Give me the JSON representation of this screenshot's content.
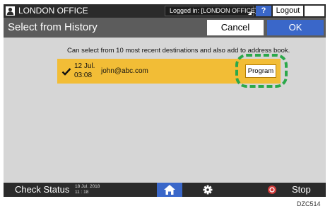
{
  "topbar": {
    "office_label": "LONDON OFFICE",
    "login_status": "Logged in: [LONDON OFFICE]",
    "help_label": "?",
    "logout_label": "Logout",
    "icons": [
      "user-icon",
      "energy-saver-icon"
    ]
  },
  "titlebar": {
    "title": "Select from History",
    "cancel_label": "Cancel",
    "ok_label": "OK"
  },
  "main": {
    "info_text": "Can select from 10 most recent destinations and also add to address book.",
    "history_rows": [
      {
        "checked": true,
        "date": "12 Jul.",
        "time": "03:08",
        "destination": "john@abc.com",
        "program_label": "Program"
      }
    ]
  },
  "bottombar": {
    "check_status_label": "Check Status",
    "date": "18 Jul. 2018",
    "time": "11 : 18",
    "stop_label": "Stop",
    "icons": [
      "home-icon",
      "settings-icon",
      "stop-icon"
    ]
  },
  "figure_code": "DZC514",
  "colors": {
    "accent_blue": "#3a67c9",
    "row_highlight": "#f2bd36",
    "callout_green": "#2ba84a",
    "bar_dark": "#2b2b2b",
    "title_gray": "#5c5c5c",
    "panel_gray": "#d6d6d6"
  }
}
